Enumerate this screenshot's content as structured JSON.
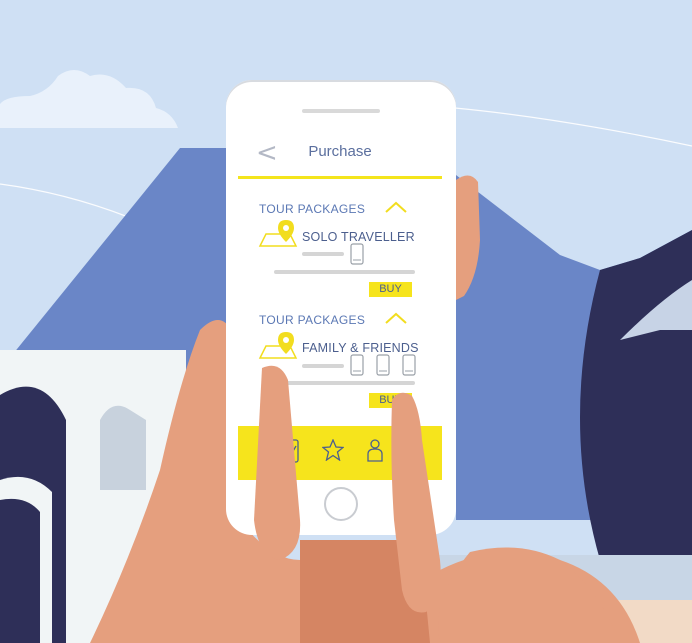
{
  "header": {
    "back_icon": "chevron-left-icon",
    "title": "Purchase"
  },
  "packages": [
    {
      "section_label": "TOUR PACKAGES",
      "name": "SOLO TRAVELLER",
      "buy_label": "BUY",
      "device_count": 1
    },
    {
      "section_label": "TOUR PACKAGES",
      "name": "FAMILY & FRIENDS",
      "buy_label": "BUY",
      "device_count": 3
    }
  ],
  "tabbar": {
    "icons": [
      "phone-icon",
      "star-icon",
      "user-icon"
    ]
  },
  "colors": {
    "accent_yellow": "#f6e41c",
    "text_blue": "#5b78b4",
    "sky": "#cfe0f4",
    "mountain_blue": "#6a86c7",
    "dark_navy": "#2c2c54",
    "skin": "#e59f7e"
  }
}
